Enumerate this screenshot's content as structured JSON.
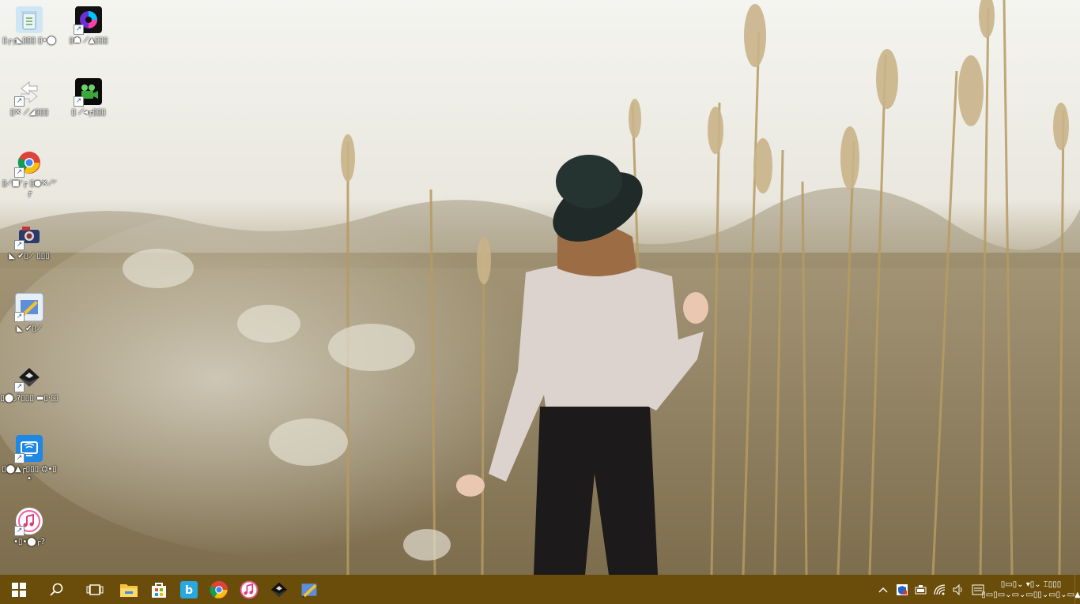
{
  "desktop": {
    "icons": [
      {
        "name": "recycle-bin",
        "label": "▯┌┌◣▯▯▯ ▯•⬤",
        "icon": "recycle-bin-icon",
        "color": "#9cc8e6"
      },
      {
        "name": "color-app",
        "label": "▯☗ ⟋▲▯▯▯",
        "icon": "color-wheel-icon",
        "color": "#1a1a2e"
      },
      {
        "name": "network-app",
        "label": "▯✕ ⟋◢▯▯▯",
        "icon": "arrows-icon",
        "color": "#ffffff"
      },
      {
        "name": "video-app",
        "label": "▯ ⟋◂┌▯▯▯",
        "icon": "film-camera-icon",
        "color": "#2a8f2a"
      },
      {
        "name": "chrome",
        "label": "▯⟋■◜┌ ▯●✕⟋◜┌",
        "icon": "chrome-icon",
        "color": "#4285f4"
      },
      {
        "name": "camera-app",
        "label": "◣ ✔▯⟋ ▯▯▯",
        "icon": "camera-icon",
        "color": "#b03030"
      },
      {
        "name": "paint-app",
        "label": "◣ ✔▯⟋",
        "icon": "paint-icon",
        "color": "#3a7bd5"
      },
      {
        "name": "ink-app",
        "label": "▯⬤◞?▯▯▯ ▬▯·□",
        "icon": "ink-icon",
        "color": "#222222"
      },
      {
        "name": "intel-app",
        "label": "▯⬤▲┌▯▯▯ ⛭•▯•",
        "icon": "intel-icon",
        "color": "#1e88e5"
      },
      {
        "name": "itunes",
        "label": "•▯•⬤┌?",
        "icon": "music-note-icon",
        "color": "#e94b8a"
      }
    ]
  },
  "taskbar": {
    "start_label": "Start",
    "search_glyph": "⌕",
    "taskview_glyph": "⧉",
    "pinned": [
      {
        "name": "file-explorer",
        "glyph": "📁"
      },
      {
        "name": "store",
        "glyph": "🛍"
      },
      {
        "name": "bluestacks",
        "glyph": "b"
      },
      {
        "name": "chrome",
        "glyph": "◉"
      },
      {
        "name": "itunes",
        "glyph": "♫"
      },
      {
        "name": "ink-app",
        "glyph": "◆"
      },
      {
        "name": "paint-app",
        "glyph": "✎"
      }
    ],
    "tray": {
      "chevron": "^",
      "security": "⛨",
      "battery": "▭",
      "wifi": "◠",
      "volume": "🔈",
      "notifications": "☰"
    },
    "clock": {
      "time": "▯▭▯⌄ ▾▯⌄ ⌶▯▯▯",
      "date": "▯▭▯▭⌄▭⌄▭▯▯⌄▭▯⌄▭▲"
    }
  }
}
